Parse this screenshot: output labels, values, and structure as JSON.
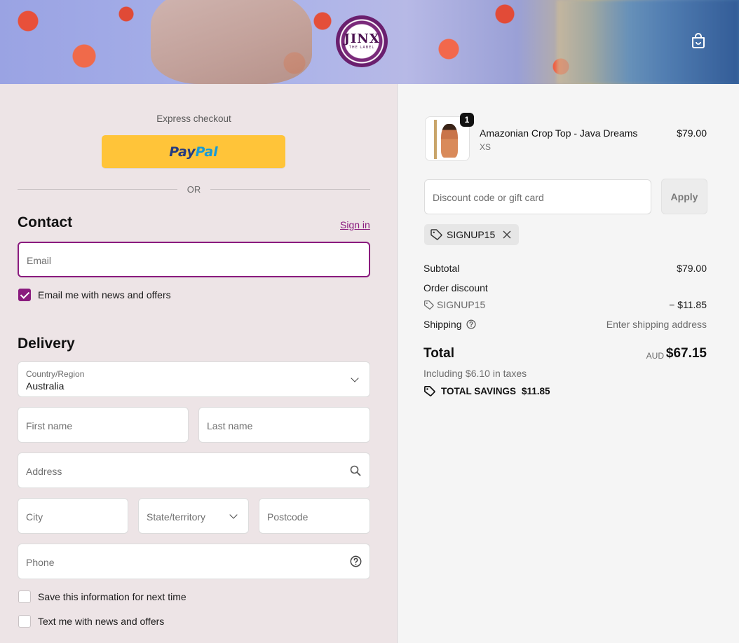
{
  "header": {
    "logo_main": "JINX",
    "logo_sub": "THE LABEL",
    "cart_icon": "bag-icon"
  },
  "express": {
    "label": "Express checkout",
    "paypal_part1": "Pay",
    "paypal_part2": "Pal",
    "or": "OR"
  },
  "contact": {
    "title": "Contact",
    "signin": "Sign in",
    "email_placeholder": "Email",
    "news_checkbox_label": "Email me with news and offers",
    "news_checked": true
  },
  "delivery": {
    "title": "Delivery",
    "country_label": "Country/Region",
    "country_value": "Australia",
    "first_name": "First name",
    "last_name": "Last name",
    "address": "Address",
    "city": "City",
    "state": "State/territory",
    "postcode": "Postcode",
    "phone": "Phone",
    "save_info_label": "Save this information for next time",
    "text_news_label": "Text me with news and offers"
  },
  "summary": {
    "item": {
      "name": "Amazonian Crop Top - Java Dreams",
      "variant": "XS",
      "price": "$79.00",
      "quantity": "1"
    },
    "discount_placeholder": "Discount code or gift card",
    "apply": "Apply",
    "applied_code": "SIGNUP15",
    "subtotal_label": "Subtotal",
    "subtotal_value": "$79.00",
    "order_discount_label": "Order discount",
    "discount_code": "SIGNUP15",
    "discount_value": "− $11.85",
    "shipping_label": "Shipping",
    "shipping_value": "Enter shipping address",
    "total_label": "Total",
    "currency": "AUD",
    "total_value": "$67.15",
    "tax_line": "Including $6.10 in taxes",
    "savings_label": "TOTAL SAVINGS",
    "savings_value": "$11.85"
  },
  "colors": {
    "accent": "#8a1b7e",
    "paypal_yellow": "#ffc439",
    "left_bg": "#ede4e6",
    "right_bg": "#f5f5f5"
  }
}
